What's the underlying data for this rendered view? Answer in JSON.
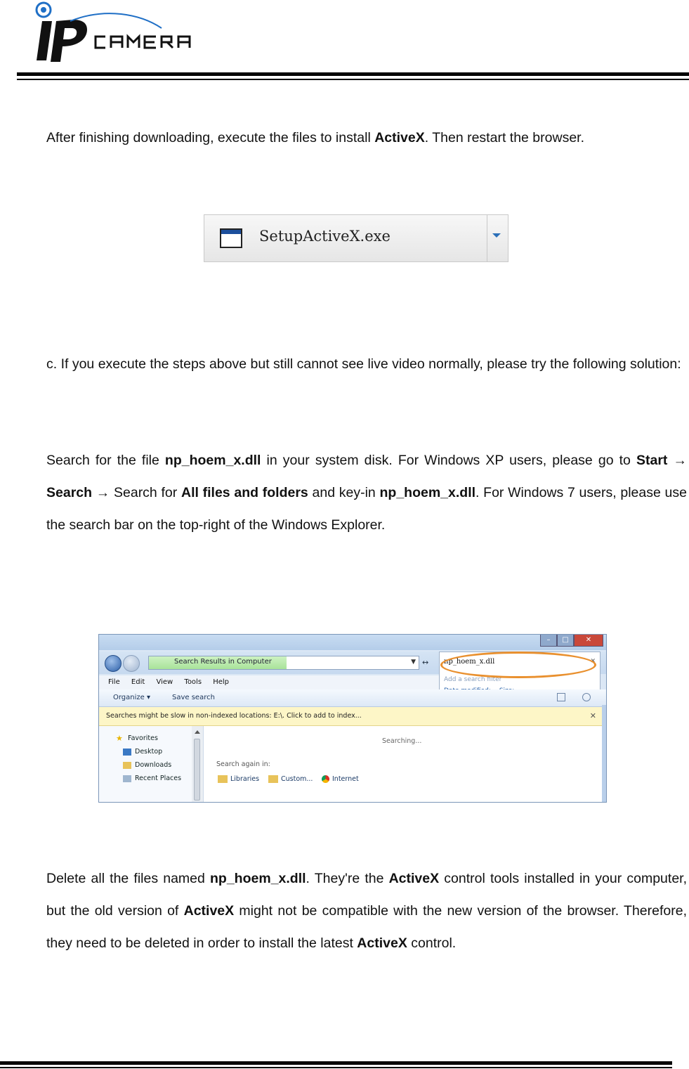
{
  "header": {
    "logo_lettering": "ip CAMERA"
  },
  "paragraphs": {
    "p1": {
      "before": "After finishing downloading, execute the files to install ",
      "bold": "ActiveX",
      "after": ". Then restart the browser."
    },
    "p2": {
      "text": "c. If you execute the steps above but still cannot see live video normally, please try the following solution:"
    },
    "p3": {
      "t1": "Search for the file ",
      "b1": "np_hoem_x.dll",
      "t2": " in your system disk. For Windows XP users, please go to ",
      "b2": "Start",
      "t3": " → ",
      "b3": "Search",
      "t4": " → Search for ",
      "b4": "All files and folders",
      "t5": " and key-in ",
      "b5": "np_hoem_x.dll",
      "t6": ". For Windows 7 users, please use the search bar on the top-right of the Windows Explorer."
    },
    "p4": {
      "t1": "Delete all the files named ",
      "b1": "np_hoem_x.dll",
      "t2": ". They're the ",
      "b2": "ActiveX",
      "t3": " control tools installed in your computer, but the old version of ",
      "b3": "ActiveX",
      "t4": " might not be compatible with the new version of the browser. Therefore, they need to be deleted in order to install the latest ",
      "b4": "ActiveX",
      "t5": " control."
    }
  },
  "download_bar": {
    "file_name": "SetupActiveX.exe",
    "icon": "window-icon"
  },
  "explorer": {
    "address_text": "Search Results in Computer",
    "search_query": "np_hoem_x.dll",
    "search_hint": "Add a search filter",
    "filter_date": "Date modified:",
    "filter_size": "Size:",
    "menu": [
      "File",
      "Edit",
      "View",
      "Tools",
      "Help"
    ],
    "toolbar": {
      "organize": "Organize ▾",
      "save_search": "Save search"
    },
    "infobar": "Searches might be slow in non-indexed locations: E:\\. Click to add to index...",
    "nav": {
      "favorites": "Favorites",
      "desktop": "Desktop",
      "downloads": "Downloads",
      "recent": "Recent Places"
    },
    "content": {
      "searching": "Searching...",
      "search_again": "Search again in:",
      "libraries": "Libraries",
      "custom": "Custom...",
      "internet": "Internet"
    },
    "highlight_color": "#e9902e"
  }
}
